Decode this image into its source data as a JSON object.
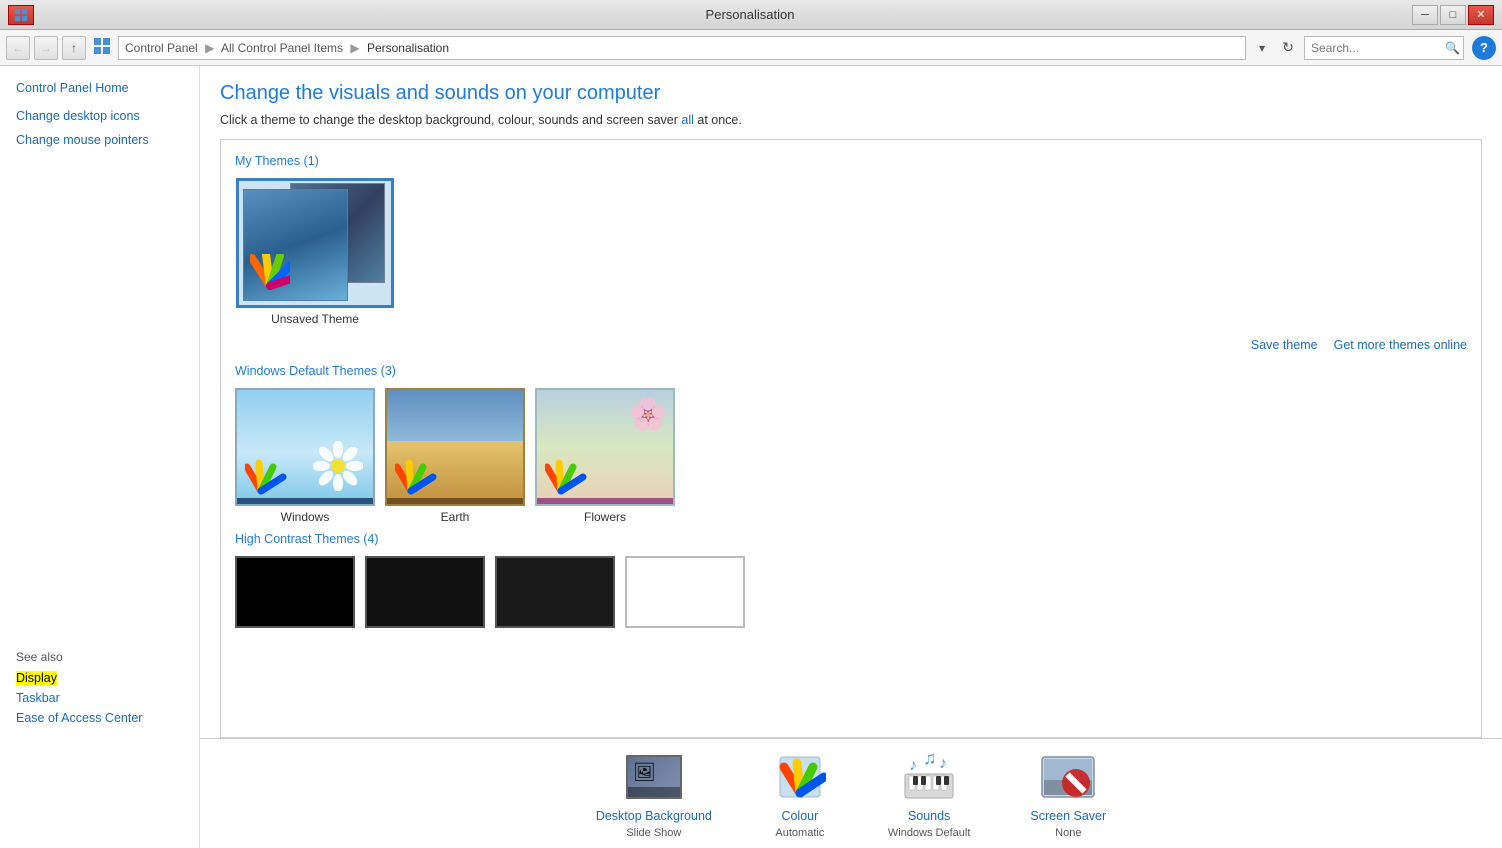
{
  "window": {
    "title": "Personalisation",
    "controls": {
      "minimize": "─",
      "maximize": "□",
      "close": "✕"
    }
  },
  "addressbar": {
    "back_tooltip": "Back",
    "forward_tooltip": "Forward",
    "up_tooltip": "Up",
    "breadcrumb": [
      "Control Panel",
      "All Control Panel Items",
      "Personalisation"
    ],
    "search_placeholder": "Search...",
    "refresh_tooltip": "Refresh"
  },
  "sidebar": {
    "links": [
      {
        "id": "control-panel-home",
        "label": "Control Panel Home"
      },
      {
        "id": "change-desktop-icons",
        "label": "Change desktop icons"
      },
      {
        "id": "change-mouse-pointers",
        "label": "Change mouse pointers"
      }
    ],
    "see_also_label": "See also",
    "see_also_links": [
      {
        "id": "display",
        "label": "Display",
        "highlight": true
      },
      {
        "id": "taskbar",
        "label": "Taskbar",
        "highlight": false
      },
      {
        "id": "ease-of-access-center",
        "label": "Ease of Access Center",
        "highlight": false
      }
    ]
  },
  "content": {
    "title": "Change the visuals and sounds on your computer",
    "description_prefix": "Click a theme to change the desktop background, colour, sounds and screen saver ",
    "description_link": "all",
    "description_suffix": " at once.",
    "my_themes_header": "My Themes (1)",
    "my_themes": [
      {
        "id": "unsaved-theme",
        "name": "Unsaved Theme",
        "selected": true
      }
    ],
    "windows_default_header": "Windows Default Themes (3)",
    "windows_themes": [
      {
        "id": "windows",
        "name": "Windows"
      },
      {
        "id": "earth",
        "name": "Earth"
      },
      {
        "id": "flowers",
        "name": "Flowers"
      }
    ],
    "high_contrast_header": "High Contrast Themes (4)",
    "actions": {
      "save_theme": "Save theme",
      "get_more": "Get more themes online"
    }
  },
  "bottom_bar": {
    "items": [
      {
        "id": "desktop-background",
        "label": "Desktop Background",
        "sublabel": "Slide Show"
      },
      {
        "id": "colour",
        "label": "Colour",
        "sublabel": "Automatic"
      },
      {
        "id": "sounds",
        "label": "Sounds",
        "sublabel": "Windows Default"
      },
      {
        "id": "screen-saver",
        "label": "Screen Saver",
        "sublabel": "None"
      }
    ]
  }
}
